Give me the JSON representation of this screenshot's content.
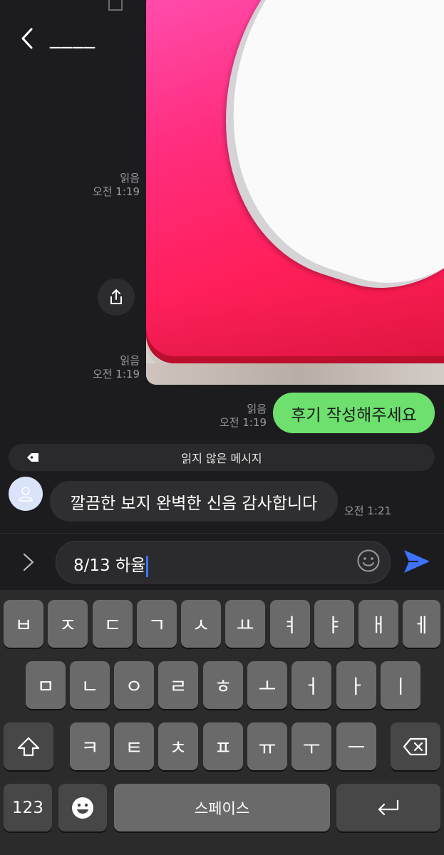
{
  "header": {
    "title": "____",
    "back_icon": "chevron-left-icon"
  },
  "messages": {
    "photo_read_1": "읽음",
    "photo_time_1": "오전 1:19",
    "photo_read_2": "읽음",
    "photo_time_2": "오전 1:19",
    "out_text": "후기 작성해주세요",
    "out_read": "읽음",
    "out_time": "오전 1:19",
    "unread_divider": "읽지 않은 메시지",
    "in_text": "깔끔한 보지 완벽한 신음 감사합니다",
    "in_time": "오전 1:21"
  },
  "input": {
    "value": "8/13 하율"
  },
  "colors": {
    "accent": "#3d73ff",
    "outgoing_bubble": "#6de06e"
  },
  "keyboard": {
    "row1": [
      "ㅂ",
      "ㅈ",
      "ㄷ",
      "ㄱ",
      "ㅅ",
      "ㅛ",
      "ㅕ",
      "ㅑ",
      "ㅐ",
      "ㅔ"
    ],
    "row2": [
      "ㅁ",
      "ㄴ",
      "ㅇ",
      "ㄹ",
      "ㅎ",
      "ㅗ",
      "ㅓ",
      "ㅏ",
      "ㅣ"
    ],
    "row3": [
      "ㅋ",
      "ㅌ",
      "ㅊ",
      "ㅍ",
      "ㅠ",
      "ㅜ",
      "ㅡ"
    ],
    "numbers_label": "123",
    "space_label": "스페이스"
  }
}
